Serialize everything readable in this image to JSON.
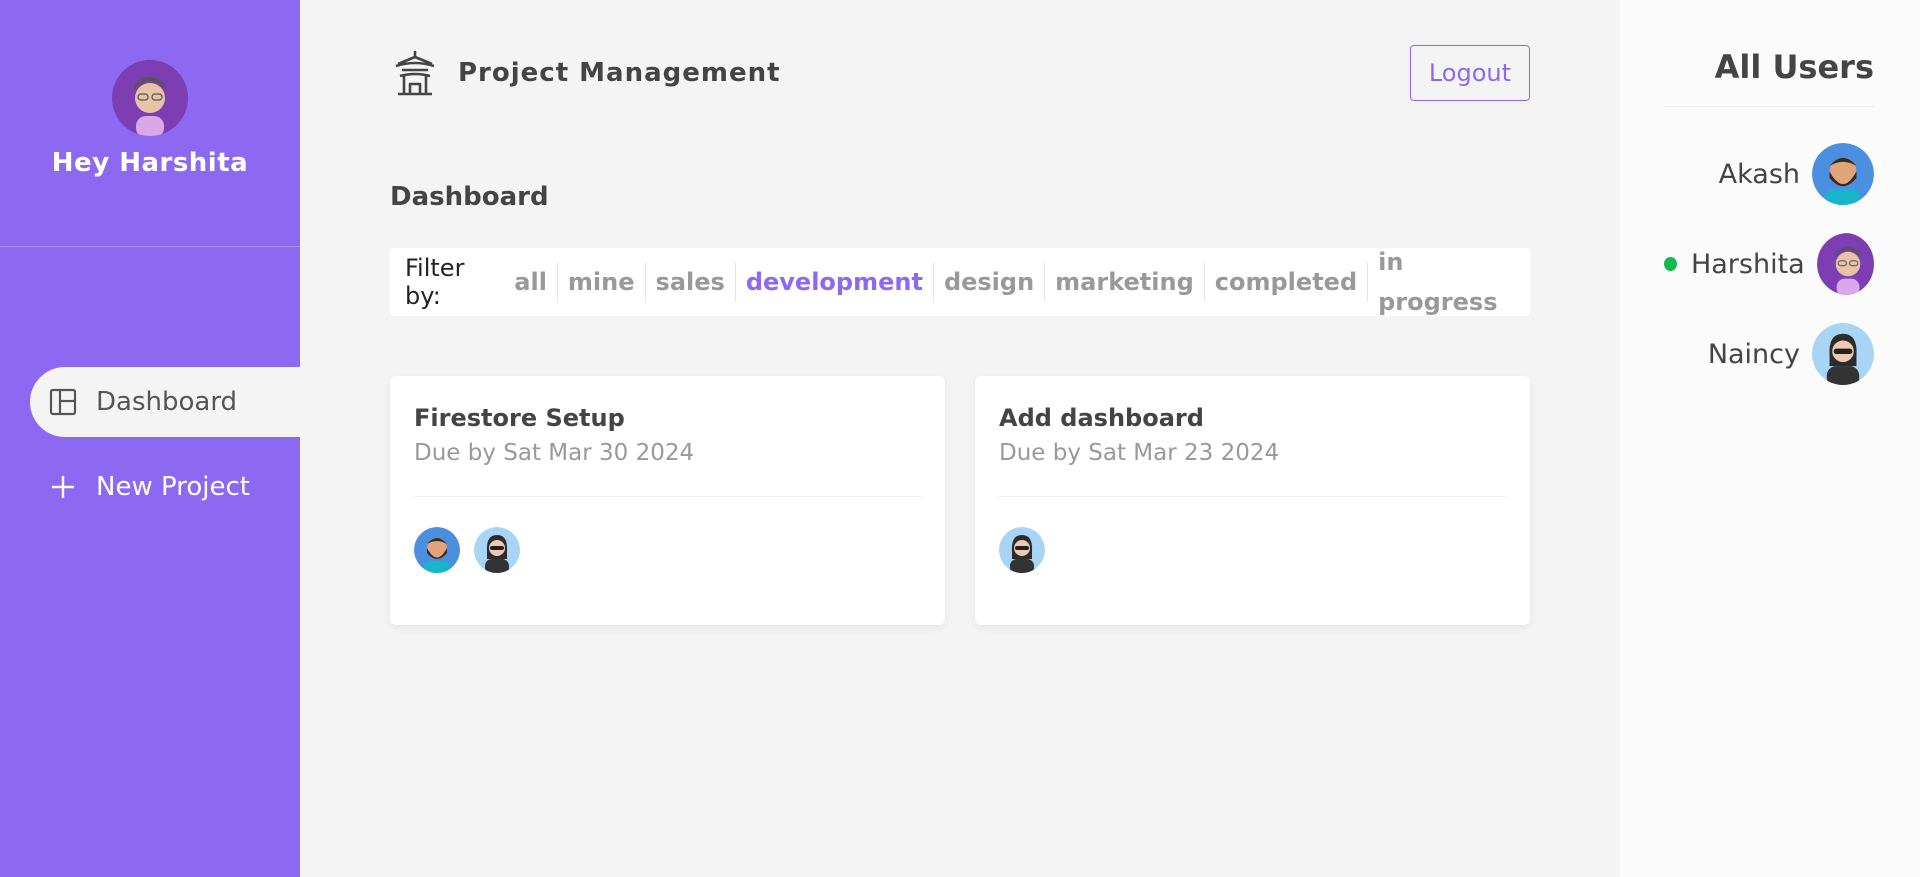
{
  "sidebar": {
    "greeting": "Hey Harshita",
    "nav": [
      {
        "label": "Dashboard",
        "icon": "dashboard-icon",
        "active": true
      },
      {
        "label": "New Project",
        "icon": "plus-icon",
        "active": false
      }
    ]
  },
  "header": {
    "title": "Project Management",
    "logo_icon": "temple-icon",
    "logout_label": "Logout"
  },
  "main": {
    "page_title": "Dashboard",
    "filter": {
      "label": "Filter by:",
      "options": [
        "all",
        "mine",
        "sales",
        "development",
        "design",
        "marketing",
        "completed",
        "in progress"
      ],
      "selected": "development"
    },
    "projects": [
      {
        "title": "Firestore Setup",
        "due": "Due by Sat Mar 30 2024",
        "assignees": [
          "Akash",
          "Naincy"
        ]
      },
      {
        "title": "Add dashboard",
        "due": "Due by Sat Mar 23 2024",
        "assignees": [
          "Naincy"
        ]
      }
    ]
  },
  "users_panel": {
    "title": "All Users",
    "users": [
      {
        "name": "Akash",
        "online": false
      },
      {
        "name": "Harshita",
        "online": true
      },
      {
        "name": "Naincy",
        "online": false
      }
    ]
  },
  "colors": {
    "accent": "#8d69f1",
    "online": "#0ebb50",
    "background": "#f4f4f4"
  }
}
